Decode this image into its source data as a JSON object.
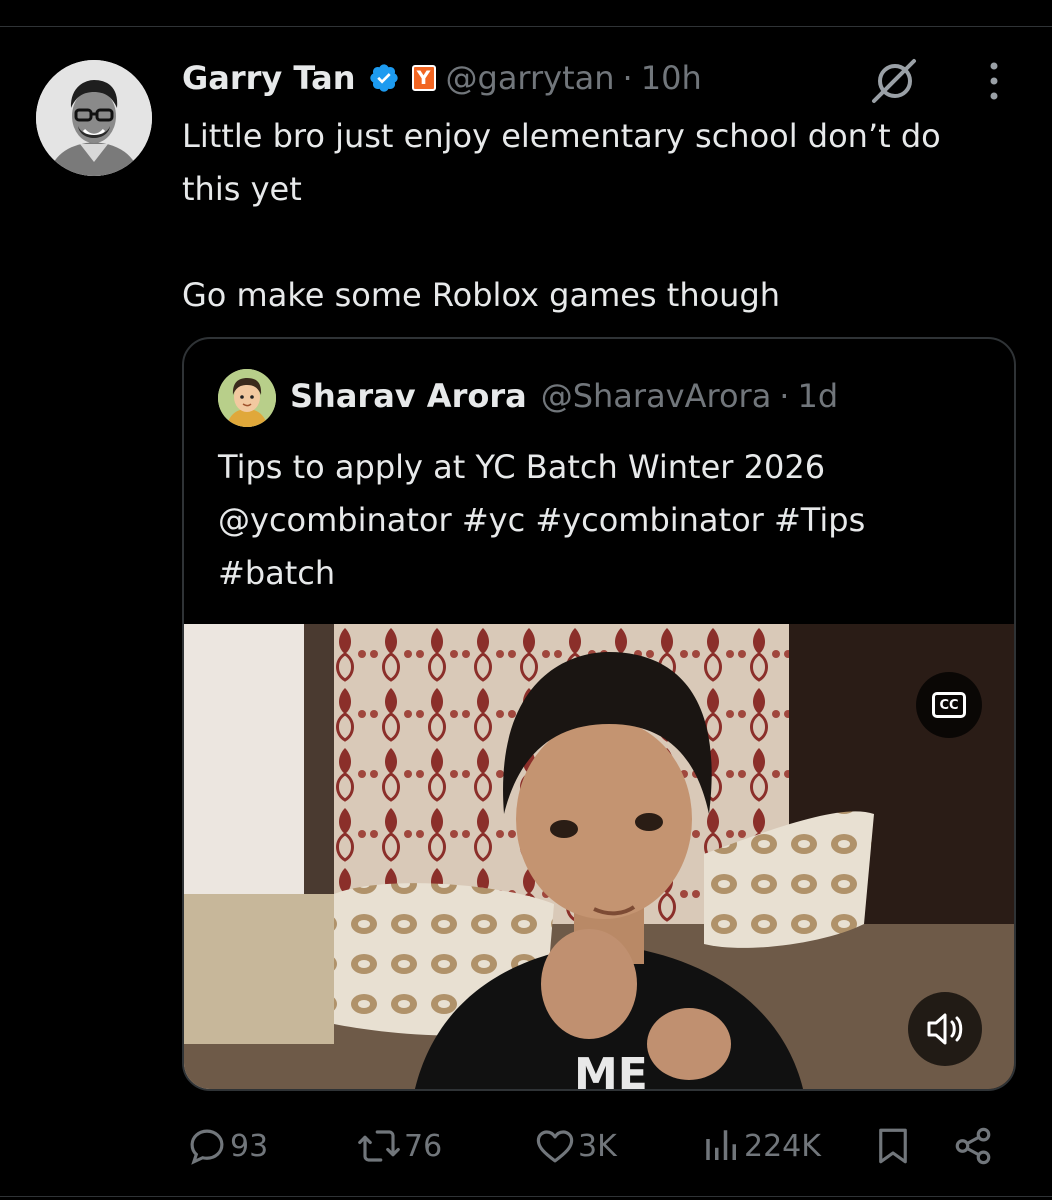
{
  "tweet": {
    "author_name": "Garry Tan",
    "author_badge": "Y",
    "author_handle": "@garrytan",
    "separator": "·",
    "time": "10h",
    "text": "Little bro just enjoy elementary school don’t do\nthis yet\n\nGo make some Roblox games though"
  },
  "quote": {
    "author_name": "Sharav Arora",
    "author_handle": "@SharavArora",
    "separator": "·",
    "time": "1d",
    "text": "Tips to apply at YC Batch Winter 2026\n@ycombinator #yc #ycombinator #Tips\n#batch",
    "video": {
      "cc_label": "CC",
      "shirt_text": "ME"
    }
  },
  "actions": {
    "replies": "93",
    "reposts": "76",
    "likes": "3K",
    "views": "224K"
  },
  "colors": {
    "background": "#000000",
    "text_primary": "#e7e9ea",
    "text_secondary": "#71767b",
    "verified_blue": "#1d9bf0",
    "yc_orange": "#f26522",
    "border": "#2f3336"
  },
  "icons": {
    "verified": "verified-badge-icon",
    "grok": "grok-icon",
    "more": "more-vertical-icon",
    "reply": "reply-icon",
    "repost": "repost-icon",
    "like": "heart-icon",
    "views": "views-chart-icon",
    "bookmark": "bookmark-icon",
    "share": "share-icon",
    "cc": "closed-captions-icon",
    "volume": "volume-icon"
  }
}
